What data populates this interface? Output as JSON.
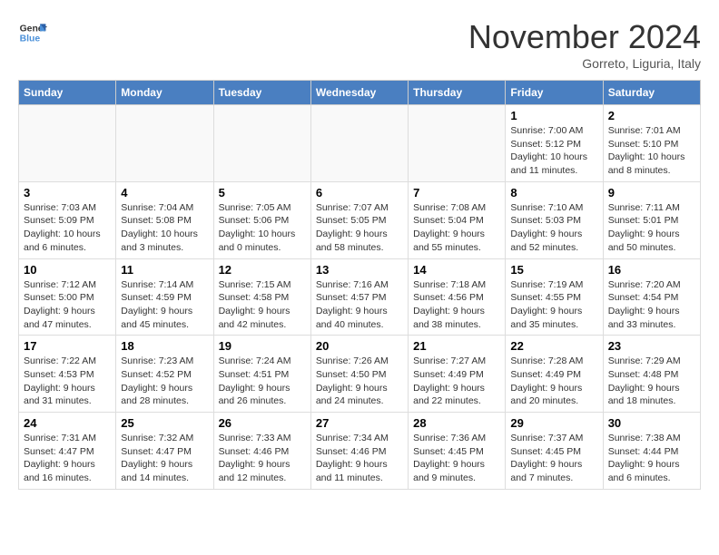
{
  "logo": {
    "text_general": "General",
    "text_blue": "Blue"
  },
  "title": "November 2024",
  "location": "Gorreto, Liguria, Italy",
  "days_of_week": [
    "Sunday",
    "Monday",
    "Tuesday",
    "Wednesday",
    "Thursday",
    "Friday",
    "Saturday"
  ],
  "weeks": [
    [
      {
        "day": "",
        "info": ""
      },
      {
        "day": "",
        "info": ""
      },
      {
        "day": "",
        "info": ""
      },
      {
        "day": "",
        "info": ""
      },
      {
        "day": "",
        "info": ""
      },
      {
        "day": "1",
        "info": "Sunrise: 7:00 AM\nSunset: 5:12 PM\nDaylight: 10 hours and 11 minutes."
      },
      {
        "day": "2",
        "info": "Sunrise: 7:01 AM\nSunset: 5:10 PM\nDaylight: 10 hours and 8 minutes."
      }
    ],
    [
      {
        "day": "3",
        "info": "Sunrise: 7:03 AM\nSunset: 5:09 PM\nDaylight: 10 hours and 6 minutes."
      },
      {
        "day": "4",
        "info": "Sunrise: 7:04 AM\nSunset: 5:08 PM\nDaylight: 10 hours and 3 minutes."
      },
      {
        "day": "5",
        "info": "Sunrise: 7:05 AM\nSunset: 5:06 PM\nDaylight: 10 hours and 0 minutes."
      },
      {
        "day": "6",
        "info": "Sunrise: 7:07 AM\nSunset: 5:05 PM\nDaylight: 9 hours and 58 minutes."
      },
      {
        "day": "7",
        "info": "Sunrise: 7:08 AM\nSunset: 5:04 PM\nDaylight: 9 hours and 55 minutes."
      },
      {
        "day": "8",
        "info": "Sunrise: 7:10 AM\nSunset: 5:03 PM\nDaylight: 9 hours and 52 minutes."
      },
      {
        "day": "9",
        "info": "Sunrise: 7:11 AM\nSunset: 5:01 PM\nDaylight: 9 hours and 50 minutes."
      }
    ],
    [
      {
        "day": "10",
        "info": "Sunrise: 7:12 AM\nSunset: 5:00 PM\nDaylight: 9 hours and 47 minutes."
      },
      {
        "day": "11",
        "info": "Sunrise: 7:14 AM\nSunset: 4:59 PM\nDaylight: 9 hours and 45 minutes."
      },
      {
        "day": "12",
        "info": "Sunrise: 7:15 AM\nSunset: 4:58 PM\nDaylight: 9 hours and 42 minutes."
      },
      {
        "day": "13",
        "info": "Sunrise: 7:16 AM\nSunset: 4:57 PM\nDaylight: 9 hours and 40 minutes."
      },
      {
        "day": "14",
        "info": "Sunrise: 7:18 AM\nSunset: 4:56 PM\nDaylight: 9 hours and 38 minutes."
      },
      {
        "day": "15",
        "info": "Sunrise: 7:19 AM\nSunset: 4:55 PM\nDaylight: 9 hours and 35 minutes."
      },
      {
        "day": "16",
        "info": "Sunrise: 7:20 AM\nSunset: 4:54 PM\nDaylight: 9 hours and 33 minutes."
      }
    ],
    [
      {
        "day": "17",
        "info": "Sunrise: 7:22 AM\nSunset: 4:53 PM\nDaylight: 9 hours and 31 minutes."
      },
      {
        "day": "18",
        "info": "Sunrise: 7:23 AM\nSunset: 4:52 PM\nDaylight: 9 hours and 28 minutes."
      },
      {
        "day": "19",
        "info": "Sunrise: 7:24 AM\nSunset: 4:51 PM\nDaylight: 9 hours and 26 minutes."
      },
      {
        "day": "20",
        "info": "Sunrise: 7:26 AM\nSunset: 4:50 PM\nDaylight: 9 hours and 24 minutes."
      },
      {
        "day": "21",
        "info": "Sunrise: 7:27 AM\nSunset: 4:49 PM\nDaylight: 9 hours and 22 minutes."
      },
      {
        "day": "22",
        "info": "Sunrise: 7:28 AM\nSunset: 4:49 PM\nDaylight: 9 hours and 20 minutes."
      },
      {
        "day": "23",
        "info": "Sunrise: 7:29 AM\nSunset: 4:48 PM\nDaylight: 9 hours and 18 minutes."
      }
    ],
    [
      {
        "day": "24",
        "info": "Sunrise: 7:31 AM\nSunset: 4:47 PM\nDaylight: 9 hours and 16 minutes."
      },
      {
        "day": "25",
        "info": "Sunrise: 7:32 AM\nSunset: 4:47 PM\nDaylight: 9 hours and 14 minutes."
      },
      {
        "day": "26",
        "info": "Sunrise: 7:33 AM\nSunset: 4:46 PM\nDaylight: 9 hours and 12 minutes."
      },
      {
        "day": "27",
        "info": "Sunrise: 7:34 AM\nSunset: 4:46 PM\nDaylight: 9 hours and 11 minutes."
      },
      {
        "day": "28",
        "info": "Sunrise: 7:36 AM\nSunset: 4:45 PM\nDaylight: 9 hours and 9 minutes."
      },
      {
        "day": "29",
        "info": "Sunrise: 7:37 AM\nSunset: 4:45 PM\nDaylight: 9 hours and 7 minutes."
      },
      {
        "day": "30",
        "info": "Sunrise: 7:38 AM\nSunset: 4:44 PM\nDaylight: 9 hours and 6 minutes."
      }
    ]
  ]
}
